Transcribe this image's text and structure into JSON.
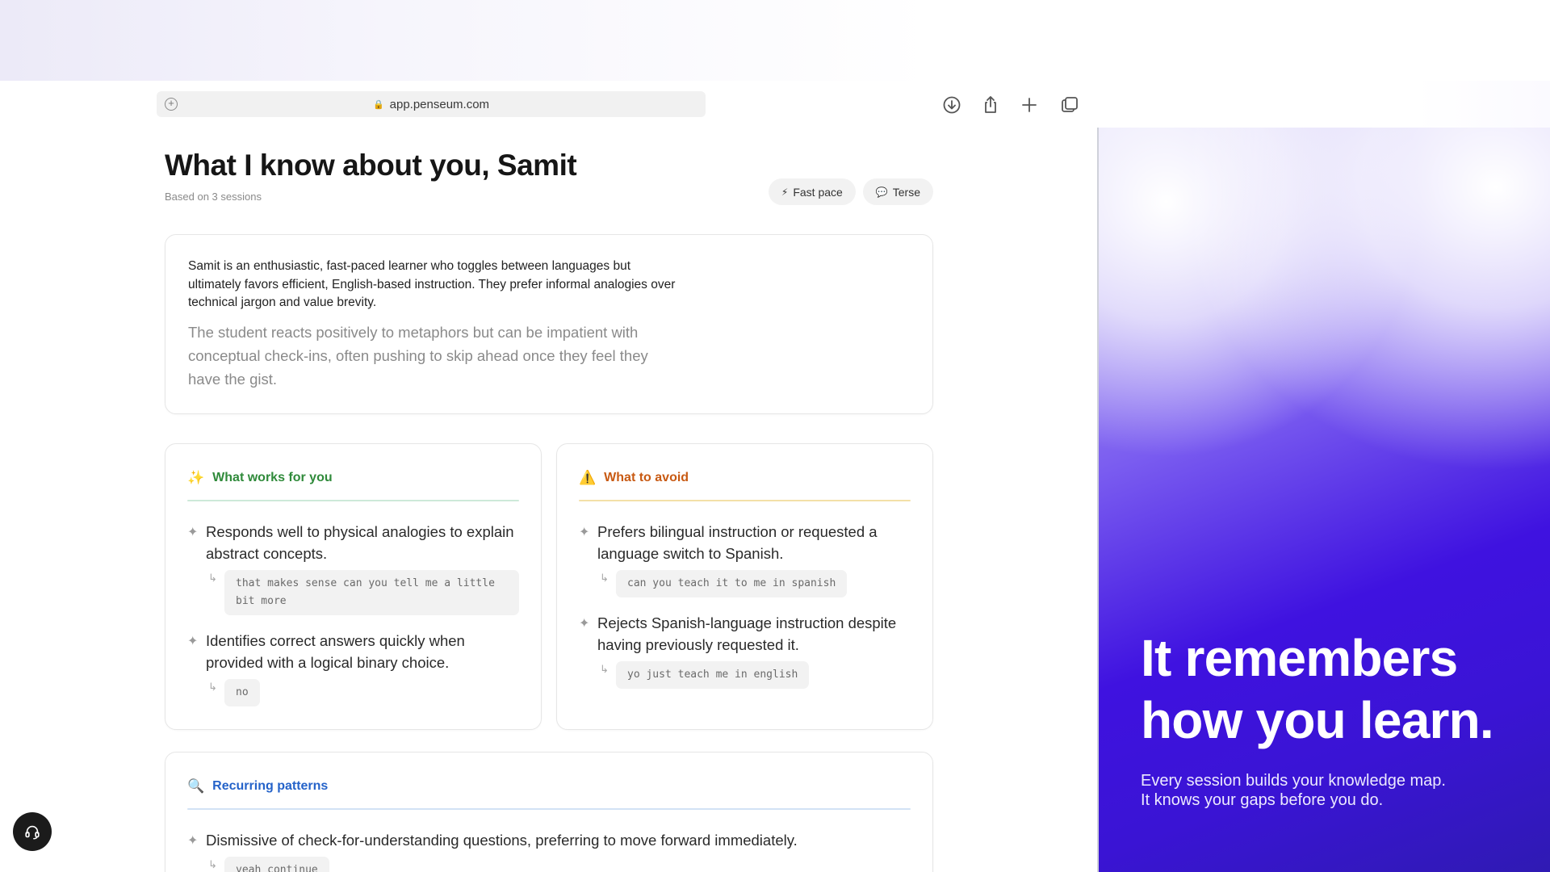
{
  "browser": {
    "url": "app.penseum.com",
    "lock_glyph": "🔒"
  },
  "profile": {
    "title": "What I know about you, Samit",
    "subtitle": "Based on 3 sessions",
    "tags": [
      {
        "icon": "⚡",
        "label": "Fast pace"
      },
      {
        "icon": "💬",
        "label": "Terse"
      }
    ]
  },
  "summary": {
    "primary": "Samit is an enthusiastic, fast-paced learner who toggles between languages but ultimately favors efficient, English-based instruction. They prefer informal analogies over technical jargon and value brevity.",
    "secondary": "The student reacts positively to metaphors but can be impatient with conceptual check-ins, often pushing to skip ahead once they feel they have the gist."
  },
  "works": {
    "icon": "✨",
    "heading": "What works for you",
    "items": [
      {
        "text": "Responds well to physical analogies to explain abstract concepts.",
        "quote": "that makes sense can you tell me a little bit more"
      },
      {
        "text": "Identifies correct answers quickly when provided with a logical binary choice.",
        "quote": "no"
      }
    ]
  },
  "avoid": {
    "icon": "⚠️",
    "heading": "What to avoid",
    "items": [
      {
        "text": "Prefers bilingual instruction or requested a language switch to Spanish.",
        "quote": "can you teach it to me in spanish"
      },
      {
        "text": "Rejects Spanish-language instruction despite having previously requested it.",
        "quote": "yo just teach me in english"
      }
    ]
  },
  "patterns": {
    "icon": "🔍",
    "heading": "Recurring patterns",
    "items": [
      {
        "text": "Dismissive of check-for-understanding questions, preferring to move forward immediately.",
        "quote": "yeah continue"
      }
    ]
  },
  "marketing": {
    "headline_line1": "It remembers",
    "headline_line2": "how you learn.",
    "tagline_line1": "Every session builds your knowledge map.",
    "tagline_line2": "It knows your gaps before you do."
  },
  "glyphs": {
    "star": "✦",
    "reply_arrow": "↳"
  },
  "icons": {
    "url_left": "plus-circle-icon",
    "toolbar": [
      "download-icon",
      "share-icon",
      "plus-icon",
      "tabs-icon"
    ],
    "help": "headset-icon"
  },
  "colors": {
    "works_accent": "#2f8a3a",
    "avoid_accent": "#c85a13",
    "patterns_accent": "#2563c9",
    "panel_gradient_deep": "#3f12e0"
  }
}
